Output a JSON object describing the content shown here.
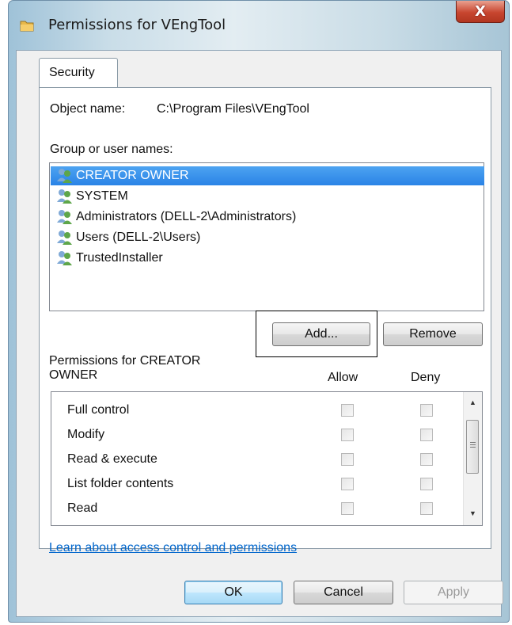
{
  "window": {
    "title": "Permissions for VEngTool",
    "close_label": "X"
  },
  "tabs": [
    {
      "label": "Security",
      "selected": true
    }
  ],
  "object": {
    "label": "Object name:",
    "value": "C:\\Program Files\\VEngTool"
  },
  "groups": {
    "label": "Group or user names:",
    "items": [
      {
        "name": "CREATOR OWNER",
        "selected": true
      },
      {
        "name": "SYSTEM",
        "selected": false
      },
      {
        "name": "Administrators (DELL-2\\Administrators)",
        "selected": false
      },
      {
        "name": "Users (DELL-2\\Users)",
        "selected": false
      },
      {
        "name": "TrustedInstaller",
        "selected": false
      }
    ]
  },
  "buttons": {
    "add": "Add...",
    "remove": "Remove",
    "ok": "OK",
    "cancel": "Cancel",
    "apply": "Apply"
  },
  "permissions": {
    "label_line1": "Permissions for CREATOR",
    "label_line2": "OWNER",
    "allow_header": "Allow",
    "deny_header": "Deny",
    "rows": [
      {
        "name": "Full control",
        "allow": false,
        "deny": false
      },
      {
        "name": "Modify",
        "allow": false,
        "deny": false
      },
      {
        "name": "Read & execute",
        "allow": false,
        "deny": false
      },
      {
        "name": "List folder contents",
        "allow": false,
        "deny": false
      },
      {
        "name": "Read",
        "allow": false,
        "deny": false
      }
    ]
  },
  "link": "Learn about access control and permissions",
  "icons": {
    "app": "folder-icon",
    "users": "user-group-icon",
    "close": "close-icon"
  },
  "colors": {
    "selection": "#3399ff",
    "link": "#0066cc",
    "close_button": "#c8462f"
  }
}
